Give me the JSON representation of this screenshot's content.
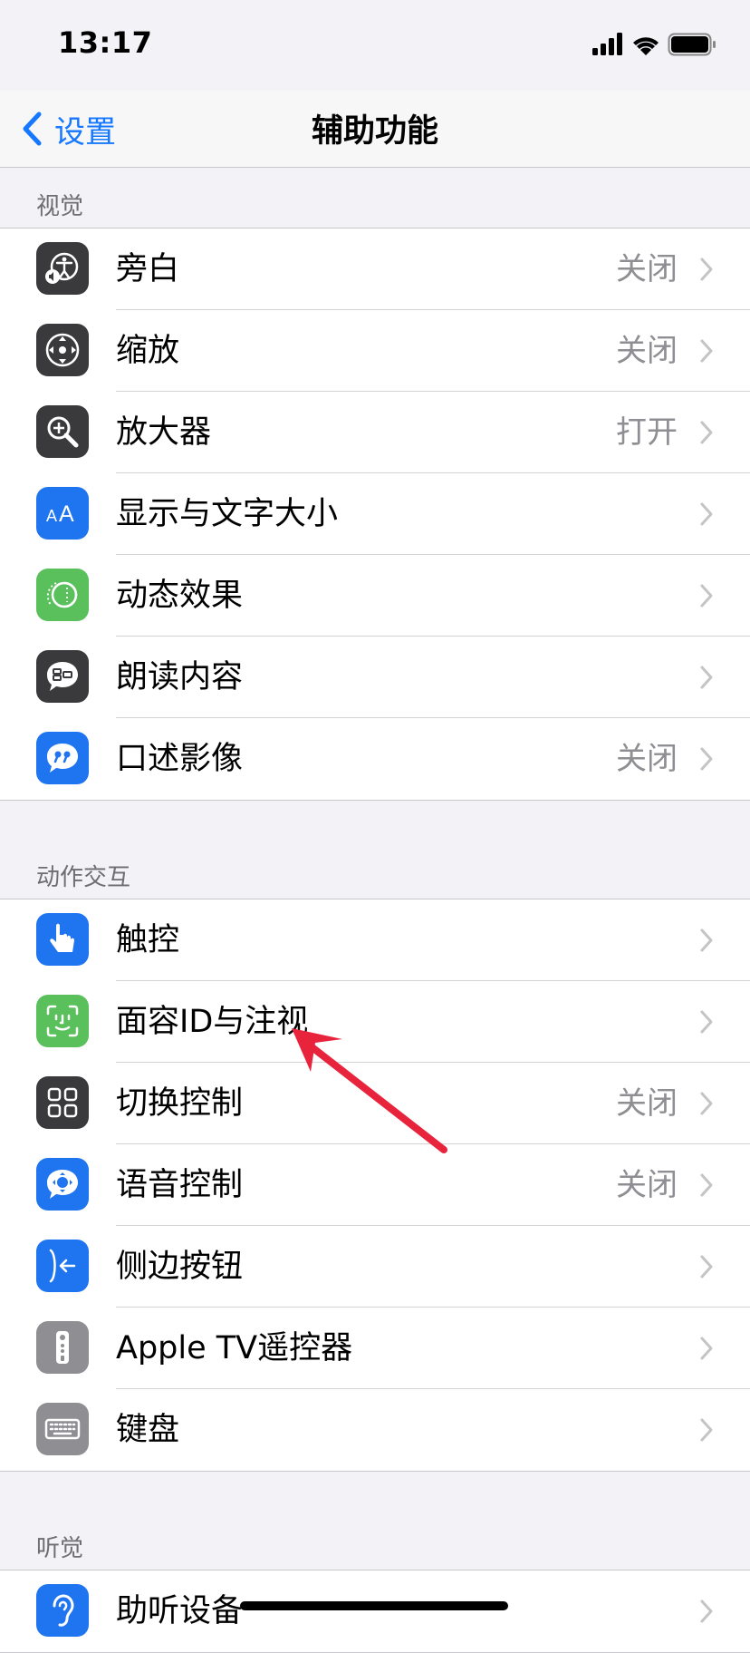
{
  "status_bar": {
    "time": "13:17"
  },
  "nav": {
    "back_label": "设置",
    "title": "辅助功能"
  },
  "sections": {
    "vision": {
      "header": "视觉",
      "rows": [
        {
          "label": "旁白",
          "value": "关闭",
          "icon": "voiceover-icon"
        },
        {
          "label": "缩放",
          "value": "关闭",
          "icon": "zoom-icon"
        },
        {
          "label": "放大器",
          "value": "打开",
          "icon": "magnifier-icon"
        },
        {
          "label": "显示与文字大小",
          "value": "",
          "icon": "text-size-icon"
        },
        {
          "label": "动态效果",
          "value": "",
          "icon": "motion-icon"
        },
        {
          "label": "朗读内容",
          "value": "",
          "icon": "spoken-content-icon"
        },
        {
          "label": "口述影像",
          "value": "关闭",
          "icon": "audio-description-icon"
        }
      ]
    },
    "interaction": {
      "header": "动作交互",
      "rows": [
        {
          "label": "触控",
          "value": "",
          "icon": "touch-icon"
        },
        {
          "label": "面容ID与注视",
          "value": "",
          "icon": "face-id-icon"
        },
        {
          "label": "切换控制",
          "value": "关闭",
          "icon": "switch-control-icon"
        },
        {
          "label": "语音控制",
          "value": "关闭",
          "icon": "voice-control-icon"
        },
        {
          "label": "侧边按钮",
          "value": "",
          "icon": "side-button-icon"
        },
        {
          "label": "Apple TV遥控器",
          "value": "",
          "icon": "apple-tv-remote-icon"
        },
        {
          "label": "键盘",
          "value": "",
          "icon": "keyboard-icon"
        }
      ]
    },
    "hearing": {
      "header": "听觉",
      "rows": [
        {
          "label": "助听设备",
          "value": "",
          "icon": "hearing-devices-icon"
        }
      ]
    }
  },
  "colors": {
    "accent": "#1677ff",
    "annotation_arrow": "#e8243c"
  }
}
